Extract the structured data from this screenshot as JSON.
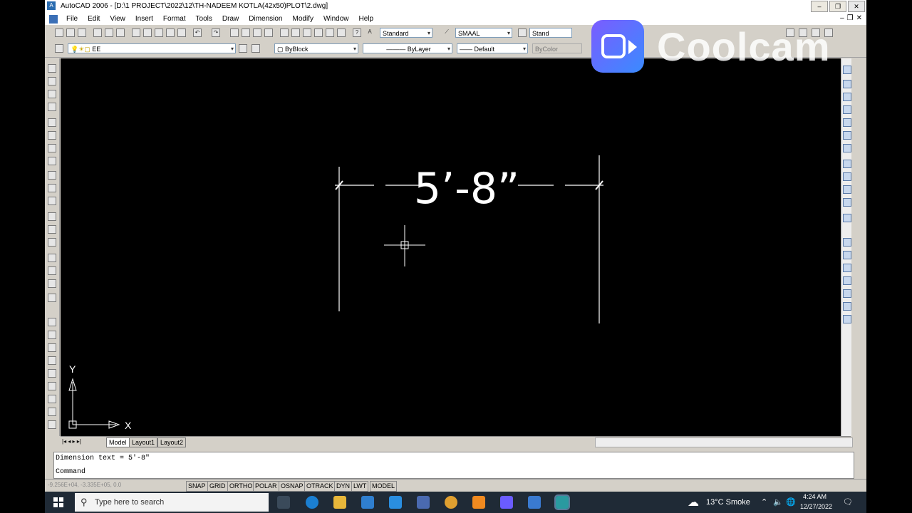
{
  "window": {
    "title": "AutoCAD 2006 - [D:\\1 PROJECT\\2022\\12\\TH-NADEEM KOTLA(42x50)PLOT\\2.dwg]"
  },
  "menu": [
    "File",
    "Edit",
    "View",
    "Insert",
    "Format",
    "Tools",
    "Draw",
    "Dimension",
    "Modify",
    "Window",
    "Help"
  ],
  "toolbar": {
    "text_style": "Standard",
    "dim_style": "SMAAL",
    "table_style": "Stand",
    "layer": "EE",
    "color": "ByBlock",
    "linetype": "ByLayer",
    "lineweight": "Default",
    "plotstyle": "ByColor"
  },
  "drawing": {
    "dimension_text": "5’-8”",
    "ucs_x": "X",
    "ucs_y": "Y"
  },
  "tabs": [
    "Model",
    "Layout1",
    "Layout2"
  ],
  "command": {
    "line1": "Dimension text = 5'-8\"",
    "line2": "Command"
  },
  "status": {
    "coords": "-9.256E+04, -3.335E+05, 0.0",
    "buttons": [
      "SNAP",
      "GRID",
      "ORTHO",
      "POLAR",
      "OSNAP",
      "OTRACK",
      "DYN",
      "LWT",
      "MODEL"
    ]
  },
  "taskbar": {
    "search_placeholder": "Type here to search",
    "weather": "13°C  Smoke",
    "time": "4:24 AM",
    "date": "12/27/2022"
  },
  "watermark": {
    "text": "Coolcam"
  }
}
